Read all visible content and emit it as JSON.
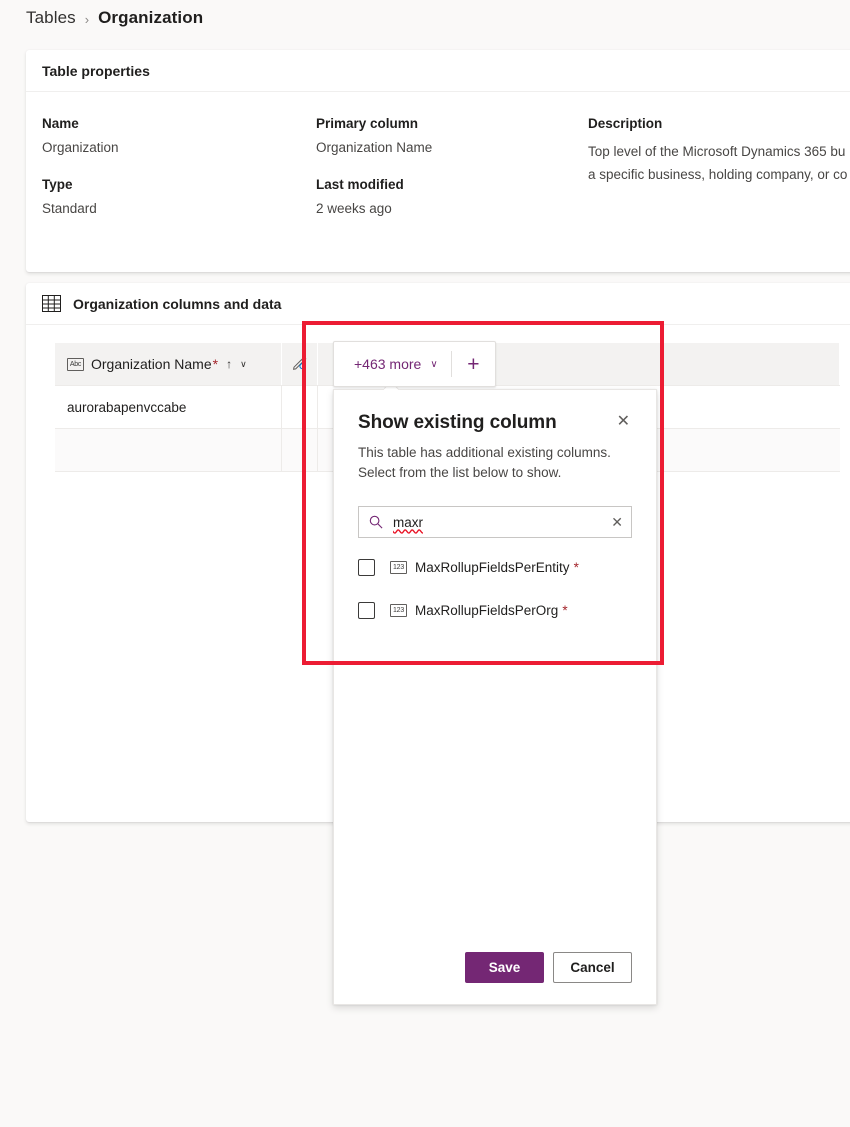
{
  "breadcrumb": {
    "parent": "Tables",
    "separator": "›",
    "current": "Organization"
  },
  "properties_card": {
    "title": "Table properties",
    "fields": [
      {
        "label": "Name",
        "value": "Organization"
      },
      {
        "label": "Type",
        "value": "Standard"
      },
      {
        "label": "Primary column",
        "value": "Organization Name"
      },
      {
        "label": "Last modified",
        "value": "2 weeks ago"
      }
    ],
    "description_label": "Description",
    "description_line1": "Top level of the Microsoft Dynamics 365 bu",
    "description_line2": "a specific business, holding company, or co"
  },
  "grid_card": {
    "title": "Organization columns and data",
    "table_icon": "table-icon",
    "columns": [
      {
        "name": "Organization Name",
        "type_icon": "Abc",
        "required_marker": "*",
        "sort_indicator": "↑",
        "chevron": "∨"
      }
    ],
    "edit_icon": "pencil-edit-icon",
    "rows": [
      {
        "organization_name": "aurorabapenvccabe"
      },
      {
        "organization_name": ""
      }
    ]
  },
  "more_columns_control": {
    "label": "+463 more",
    "chevron": "∨",
    "add_label": "+",
    "accent_color": "#742774"
  },
  "flyout": {
    "title": "Show existing column",
    "close_glyph": "✕",
    "subtitle": "This table has additional existing columns. Select from the list below to show.",
    "search": {
      "value": "maxr",
      "icon": "search-icon",
      "clear_glyph": "✕"
    },
    "columns": [
      {
        "name": "MaxRollupFieldsPerEntity",
        "type_icon": "123",
        "required_marker": "*",
        "checked": false
      },
      {
        "name": "MaxRollupFieldsPerOrg",
        "type_icon": "123",
        "required_marker": "*",
        "checked": false
      }
    ],
    "save_label": "Save",
    "cancel_label": "Cancel"
  },
  "annotation": {
    "highlight_color": "#ec1c33"
  }
}
